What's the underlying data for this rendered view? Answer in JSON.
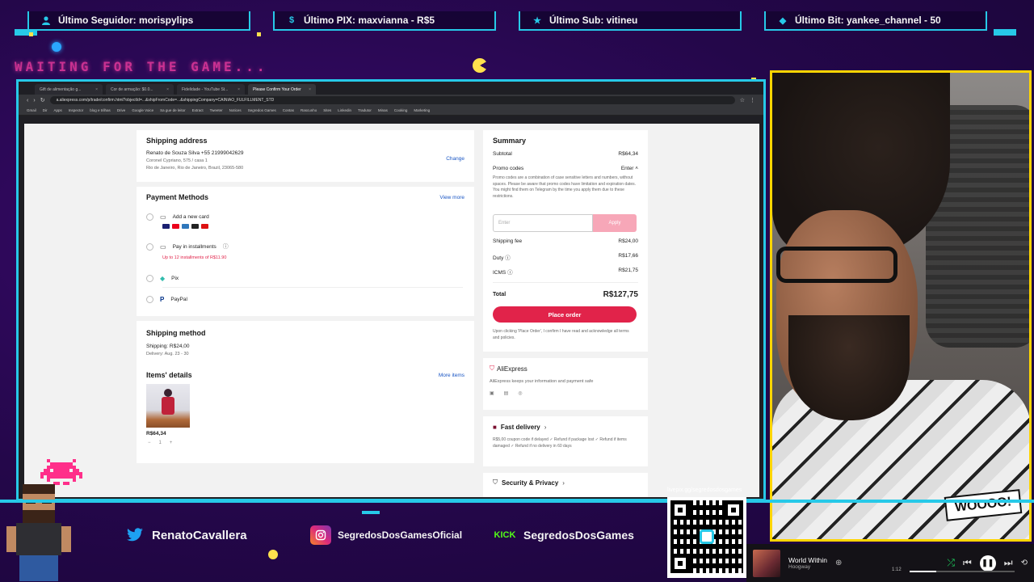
{
  "alerts": [
    {
      "icon": "user-icon",
      "label": "Último Seguidor: morispylips"
    },
    {
      "icon": "dollar-icon",
      "label": "Último PIX: maxvianna - R$5"
    },
    {
      "icon": "star-icon",
      "label": "Último Sub: vitineu"
    },
    {
      "icon": "diamond-icon",
      "label": "Último Bit: yankee_channel - 50"
    }
  ],
  "waiting_text": "WAITING FOR THE GAME...",
  "browser": {
    "tabs": [
      "Gift de alimentação g...",
      "Cor de armação: $0.0...",
      "Fidelidade - YouTube St...",
      "Please Confirm Your Order"
    ],
    "url": "a.aliexpress.com/p/trade/confirm.html?objectId=...&shipFromCode=...&shippingCompany=CAINIAO_FULFILLMENT_STD",
    "bookmarks": [
      "Gmail",
      "Dir",
      "Apps",
      "Inspector",
      "blog e trilhas",
      "Drive",
      "Google Voice",
      "Sa gue de leitor",
      "Extract",
      "Tweeter",
      "Notices",
      "Segredos Games",
      "Contas",
      "Rascunho",
      "Sites",
      "Linkedin",
      "Tradutor",
      "Minas",
      "Cooking",
      "Marketing"
    ]
  },
  "checkout": {
    "shipping": {
      "title": "Shipping address",
      "name_phone": "Renato de Souza Silva  +55 21999042629",
      "street": "Coronel Cypriano, 575 / casa 1",
      "city": "Rio de Janeiro, Rio de Janeiro, Brazil, 23065-580",
      "change": "Change"
    },
    "payment": {
      "title": "Payment Methods",
      "view_more": "View more",
      "add_card": "Add a new card",
      "installments": "Pay in installments",
      "installments_note": "Up to 12 installments of R$11.90",
      "pix": "Pix",
      "paypal": "PayPal"
    },
    "shipping_method": {
      "title": "Shipping method",
      "cost": "Shipping: R$24,00",
      "delivery": "Delivery: Aug. 23 - 30"
    },
    "items": {
      "title": "Items' details",
      "more": "More items",
      "price": "R$64,34",
      "qty": "1"
    },
    "summary": {
      "title": "Summary",
      "subtotal_label": "Subtotal",
      "subtotal": "R$64,34",
      "promo_label": "Promo codes",
      "promo_action": "Enter",
      "promo_text": "Promo codes are a combination of case sensitive letters and numbers, without spaces. Please be aware that promo codes have limitation and expiration dates. You might find them on Telegram by the time you apply them due to these restrictions.",
      "promo_placeholder": "Enter",
      "apply": "Apply",
      "shipping_fee_label": "Shipping fee",
      "shipping_fee": "R$24,00",
      "duty_label": "Duty",
      "duty": "R$17,66",
      "icms_label": "ICMS",
      "icms": "R$21,75",
      "total_label": "Total",
      "total": "R$127,75",
      "place_order": "Place order",
      "terms": "Upon clicking 'Place Order', I confirm I have read and acknowledge all terms and policies."
    },
    "aliexpress": {
      "brand": "AliExpress",
      "note": "AliExpress keeps your information and payment safe"
    },
    "fast_delivery": {
      "title": "Fast delivery",
      "note": "R$5,00 coupon code if delayed  ✓ Refund if package lost  ✓ Refund if items damaged  ✓ Refund if no delivery in 60 days"
    },
    "security": {
      "title": "Security & Privacy"
    }
  },
  "socials": [
    {
      "icon": "twitter-icon",
      "label": "RenatoCavallera"
    },
    {
      "icon": "instagram-icon",
      "label": "SegredosDosGamesOficial"
    },
    {
      "icon": "kick-icon",
      "label": "SegredosDosGames",
      "logo_text": "KICK"
    }
  ],
  "qr_label": "livepix.gg/segredosdosgames",
  "player": {
    "song": "World Within",
    "artist": "Hoogway",
    "time": "1:12",
    "progress": 0.25
  },
  "colors": {
    "accent_cyan": "#27c9e8",
    "accent_yellow": "#ffd500",
    "ali_red": "#e1234a",
    "bg_purple": "#24074a"
  }
}
